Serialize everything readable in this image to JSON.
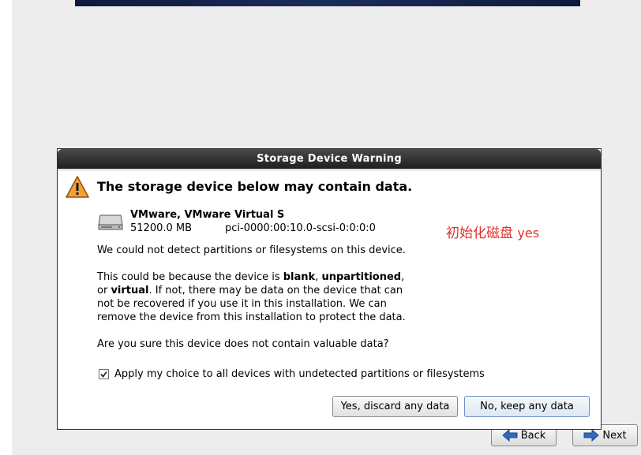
{
  "installer": {
    "back_label": "Back",
    "next_label": "Next"
  },
  "dialog": {
    "title": "Storage Device Warning",
    "headline": "The storage device below may contain data.",
    "device": {
      "name": "VMware, VMware Virtual S",
      "size": "51200.0 MB",
      "path": "pci-0000:00:10.0-scsi-0:0:0:0"
    },
    "message1": "We could not detect partitions or filesystems on this device.",
    "message2": {
      "line1_a": "This could be because the device is ",
      "line1_b": "blank",
      "line1_c": ", ",
      "line1_d": "unpartitioned",
      "line1_e": ",",
      "line2_a": "or ",
      "line2_b": "virtual",
      "line2_c": ". If not, there may be data on the device that can",
      "line3": "not be recovered if you use it in this installation. We can",
      "line4": "remove the device from this installation to protect the data."
    },
    "question": "Are you sure this device does not contain valuable data?",
    "apply_all": {
      "label": "Apply my choice to all devices with undetected partitions or filesystems",
      "checked": true
    },
    "discard_label": "Yes, discard any data",
    "keep_label": "No, keep any data"
  },
  "annotation": {
    "text_cn": "初始化磁盘 ",
    "text_en": "yes",
    "color": "#e03030"
  },
  "icons": {
    "warning": "warning-icon",
    "disk": "hard-disk-icon",
    "back": "arrow-left-icon",
    "next": "arrow-right-icon",
    "check": "checkmark-icon"
  }
}
